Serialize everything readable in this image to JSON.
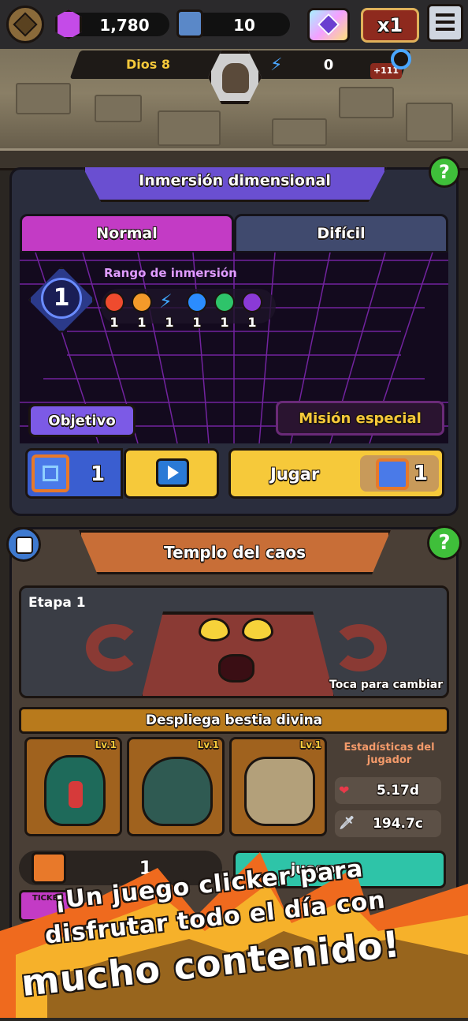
{
  "top_bar": {
    "gems": "1,780",
    "relics": "10",
    "speed": "x1",
    "menu_icon": "hamburger-menu-icon"
  },
  "level_bar": {
    "player_name": "Dios 8",
    "energy": "0",
    "bonus": "+111"
  },
  "immersion": {
    "title": "Inmersión dimensional",
    "tabs": [
      "Normal",
      "Difícil"
    ],
    "active_tab": "Normal",
    "rank_label": "Rango de inmersión",
    "rank_value": "1",
    "element_levels": [
      "1",
      "1",
      "1",
      "1",
      "1",
      "1"
    ],
    "objective_label": "Objetivo",
    "special_mission_label": "Misión especial",
    "ticket_count": "1",
    "play_label": "Jugar",
    "play_cost": "1"
  },
  "chaos_temple": {
    "title": "Templo del caos",
    "stage_label": "Etapa 1",
    "tap_hint": "Toca para cambiar",
    "deploy_label": "Despliega bestia divina",
    "beasts": [
      {
        "name": "cobra",
        "level": "Lv.1"
      },
      {
        "name": "tortoise",
        "level": "Lv.1"
      },
      {
        "name": "elephant",
        "level": "Lv.1"
      }
    ],
    "stats_title": "Estadísticas del jugador",
    "stat_hp": "5.17d",
    "stat_attack": "194.7c",
    "relic_count": "1",
    "partial_button": "juego",
    "partial_ticket": "TICKET"
  },
  "promo": {
    "line1": "¡Un juego clicker para",
    "line2": "disfrutar todo el día con",
    "line3": "mucho contenido!"
  },
  "colors": {
    "accent_purple": "#6a4fd1",
    "accent_orange": "#c86e37",
    "accent_yellow": "#f6c93a",
    "help_green": "#3fbf3a"
  }
}
